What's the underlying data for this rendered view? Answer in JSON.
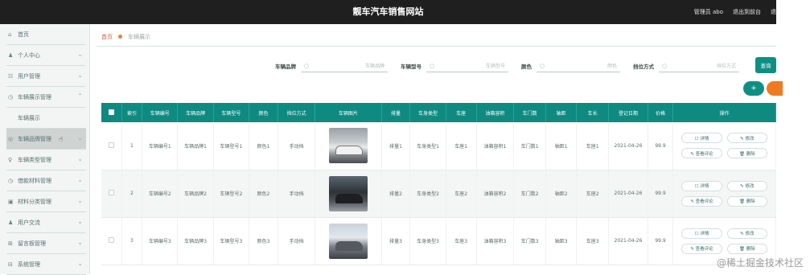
{
  "header": {
    "title": "靓车汽车销售网站",
    "links": [
      "管理员 abo",
      "退出到前台",
      "退"
    ]
  },
  "sidebar": {
    "items": [
      {
        "icon": "home-icon",
        "glyph": "⌂",
        "label": "首页",
        "chevron": false
      },
      {
        "icon": "user-icon",
        "glyph": "♟",
        "label": "个人中心",
        "chevron": true
      },
      {
        "icon": "users-icon",
        "glyph": "☷",
        "label": "用户管理",
        "chevron": true
      },
      {
        "icon": "clock-icon",
        "glyph": "◷",
        "label": "车辆展示管理",
        "chevron": true,
        "expanded": true
      },
      {
        "icon": "",
        "glyph": "",
        "label": "车辆展示",
        "sub": true
      },
      {
        "icon": "tag-icon",
        "glyph": "◎",
        "label": "车辆品牌管理",
        "chevron": true,
        "active": true
      },
      {
        "icon": "bulb-icon",
        "glyph": "♀",
        "label": "车辆类型管理",
        "chevron": true
      },
      {
        "icon": "clock-icon",
        "glyph": "◷",
        "label": "借款材料管理",
        "chevron": true
      },
      {
        "icon": "box-icon",
        "glyph": "▣",
        "label": "材料分类管理",
        "chevron": true
      },
      {
        "icon": "chat-icon",
        "glyph": "♟",
        "label": "用户交流",
        "chevron": true
      },
      {
        "icon": "grid-icon",
        "glyph": "⊞",
        "label": "留言板管理",
        "chevron": true
      },
      {
        "icon": "system-icon",
        "glyph": "⊟",
        "label": "系统管理",
        "chevron": true
      }
    ]
  },
  "breadcrumb": {
    "home": "首页",
    "current": "车辆展示"
  },
  "search": {
    "fields": [
      {
        "label": "车辆品牌",
        "placeholder": "车辆品牌"
      },
      {
        "label": "车辆型号",
        "placeholder": "车辆型号"
      },
      {
        "label": "颜色",
        "placeholder": "颜色"
      },
      {
        "label": "挡位方式",
        "placeholder": "挡位方式"
      }
    ],
    "button": "查询"
  },
  "actions": {
    "add": "+"
  },
  "table": {
    "headers": [
      "索引",
      "车辆编号",
      "车辆品牌",
      "车辆型号",
      "颜色",
      "挡位方式",
      "车辆图片",
      "排量",
      "车身类型",
      "车座",
      "油箱容积",
      "车门数",
      "轴距",
      "车长",
      "登记日期",
      "价格",
      "操作"
    ],
    "rows": [
      [
        "1",
        "车辆编号1",
        "车辆品牌1",
        "车辆型号1",
        "颜色1",
        "手动挡",
        "排量1",
        "车身类型1",
        "车座1",
        "油箱容积1",
        "车门数1",
        "轴距1",
        "车座1",
        "2021-04-26",
        "99.9"
      ],
      [
        "2",
        "车辆编号2",
        "车辆品牌2",
        "车辆型号2",
        "颜色2",
        "手动挡",
        "排量2",
        "车身类型2",
        "车座2",
        "油箱容积2",
        "车门数2",
        "轴距2",
        "车座2",
        "2021-04-26",
        "99.9"
      ],
      [
        "3",
        "车辆编号3",
        "车辆品牌3",
        "车辆型号3",
        "颜色3",
        "手动挡",
        "排量3",
        "车身类型3",
        "车座3",
        "油箱容积3",
        "车门数3",
        "轴距3",
        "车座3",
        "2021-04-26",
        "99.9"
      ]
    ],
    "ops": {
      "detail": "☐ 详情",
      "edit": "✎ 修改",
      "review": "✎ 查看评论",
      "delete": "🗑 删除"
    }
  },
  "watermark": "@稀土掘金技术社区",
  "colors": {
    "header": "#1f1f1f",
    "accent": "#0f8a80",
    "delete": "#f07a22",
    "home": "#e25c4b"
  }
}
